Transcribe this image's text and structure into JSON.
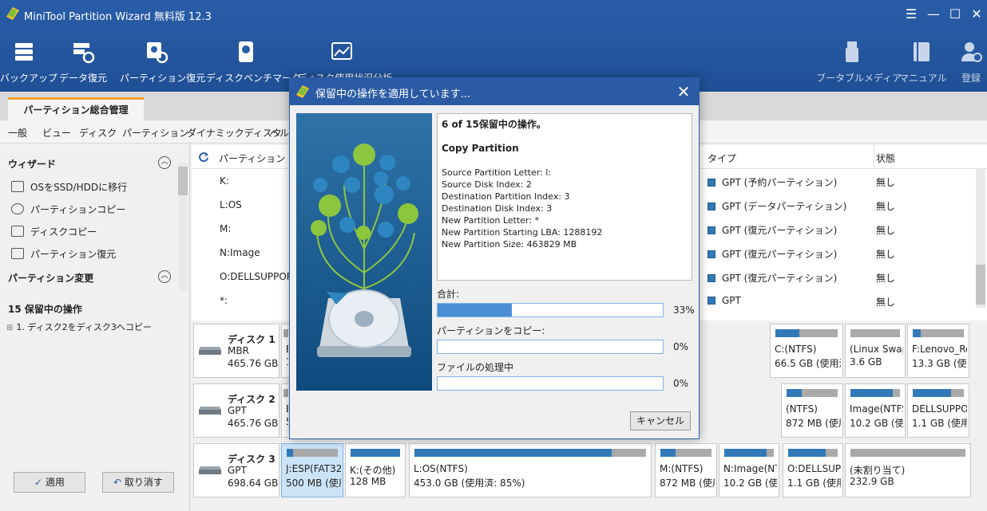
{
  "app": {
    "title": "MiniTool Partition Wizard 無料版 12.3"
  },
  "window_controls": {
    "menu": "☰",
    "minimize": "—",
    "maximize": "☐",
    "close": "✕"
  },
  "toolbar": {
    "backup": "バックアップ",
    "data_recovery": "データ復元",
    "partition_recovery": "パーティション復元",
    "disk_benchmark": "ディスクベンチマーク",
    "disk_usage": "ディスク使用状況分析",
    "bootable_media": "ブータブルメディア",
    "manual": "マニュアル",
    "register": "登録"
  },
  "tab": {
    "label": "パーティション総合管理"
  },
  "menu": [
    "一般",
    "ビュー",
    "ディスク",
    "パーティション",
    "ダイナミックディスク",
    "ヘルプ"
  ],
  "left_panel": {
    "wizard_heading": "ウィザード",
    "wizard_items": [
      "OSをSSD/HDDに移行",
      "パーティションコピー",
      "ディスクコピー",
      "パーティション復元"
    ],
    "change_heading": "パーティション変更",
    "pending_heading": "15 保留中の操作",
    "pending_items": [
      "1. ディスク2をディスク3へコピー"
    ],
    "apply_button": "適用",
    "undo_button": "取り消す"
  },
  "table": {
    "headers": {
      "partition": "パーティション",
      "type": "タイプ",
      "status": "状態"
    },
    "rows": [
      {
        "partition": "K:",
        "type": "GPT (予約パーティション)",
        "status": "無し"
      },
      {
        "partition": "L:OS",
        "type": "GPT (データパーティション)",
        "status": "無し"
      },
      {
        "partition": "M:",
        "type": "GPT (復元パーティション)",
        "status": "無し"
      },
      {
        "partition": "N:Image",
        "type": "GPT (復元パーティション)",
        "status": "無し"
      },
      {
        "partition": "O:DELLSUPPORT",
        "type": "GPT (復元パーティション)",
        "status": "無し"
      },
      {
        "partition": "*:",
        "type": "GPT",
        "status": "無し"
      }
    ]
  },
  "disks": [
    {
      "name": "ディスク 1",
      "scheme": "MBR",
      "size": "465.76 GB",
      "partitions": [
        {
          "label": "E",
          "size": "1",
          "fill": 0
        },
        {
          "label": "C:(NTFS)",
          "size": "66.5 GB (使用済",
          "fill": 0.38
        },
        {
          "label": "(Linux Swap)",
          "size": "3.6 GB",
          "fill": 0
        },
        {
          "label": "F:Lenovo_Rec",
          "size": "13.3 GB (使用",
          "fill": 0.15
        }
      ]
    },
    {
      "name": "ディスク 2",
      "scheme": "GPT",
      "size": "465.76 GB",
      "partitions": [
        {
          "label": "E",
          "size": "5",
          "fill": 0
        },
        {
          "label": "(NTFS)",
          "size": "872 MB (使用",
          "fill": 0.3
        },
        {
          "label": "Image(NTFS)",
          "size": "10.2 GB (使用",
          "fill": 0.85
        },
        {
          "label": "DELLSUPPOR",
          "size": "1.1 GB (使用済",
          "fill": 0.75
        }
      ]
    },
    {
      "name": "ディスク 3",
      "scheme": "GPT",
      "size": "698.64 GB",
      "partitions": [
        {
          "label": "J:ESP(FAT32)",
          "size": "500 MB (使用",
          "fill": 0.12
        },
        {
          "label": "K:(その他)",
          "size": "128 MB",
          "fill": 1.0
        },
        {
          "label": "L:OS(NTFS)",
          "size": "453.0 GB (使用済: 85%)",
          "fill": 0.85
        },
        {
          "label": "M:(NTFS)",
          "size": "872 MB (使用",
          "fill": 0.3
        },
        {
          "label": "N:Image(NTF",
          "size": "10.2 GB (使用",
          "fill": 0.85
        },
        {
          "label": "O:DELLSUPP(",
          "size": "1.1 GB (使用済",
          "fill": 0.75
        },
        {
          "label": "(未割り当て)",
          "size": "232.9 GB",
          "fill": 0
        }
      ]
    }
  ],
  "dialog": {
    "title": "保留中の操作を適用しています...",
    "close": "✕",
    "info_heading": "6 of 15保留中の操作。",
    "info_op": "Copy Partition",
    "info_lines": [
      "Source Partition Letter: l:",
      "Source Disk Index: 2",
      "Destination Partition Index: 3",
      "Destination Disk Index: 3",
      "New Partition Letter: *",
      "New Partition Starting LBA: 1288192",
      "New Partition Size: 463829 MB"
    ],
    "progress": [
      {
        "label": "合計:",
        "percent_text": "33%",
        "value": 0.33
      },
      {
        "label": "パーティションをコピー:",
        "percent_text": "0%",
        "value": 0
      },
      {
        "label": "ファイルの処理中",
        "percent_text": "0%",
        "value": 0
      }
    ],
    "cancel_button": "キャンセル"
  },
  "colors": {
    "header": "#2a5da8",
    "accent": "#3279b8",
    "progress": "#4a8fd5",
    "tab_accent": "#f0a030"
  }
}
